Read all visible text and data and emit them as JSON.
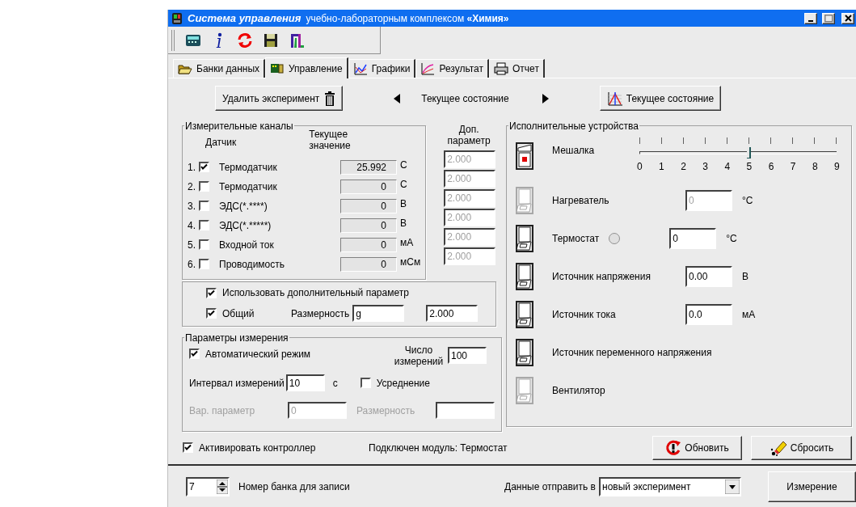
{
  "window": {
    "title_main": "Система управления",
    "title_rest": "учебно-лабораторным комплексом **«Химия»**"
  },
  "tabs": [
    {
      "label": "Банки данных",
      "selected": false
    },
    {
      "label": "Управление",
      "selected": true
    },
    {
      "label": "Графики",
      "selected": false
    },
    {
      "label": "Результат",
      "selected": false
    },
    {
      "label": "Отчет",
      "selected": false
    }
  ],
  "actions": {
    "delete_button": "Удалить эксперимент",
    "nav_label": "Текущее состояние",
    "state_button": "Текущее состояние"
  },
  "channels": {
    "title": "Измерительные каналы",
    "sensor_header": "Датчик",
    "value_header": "Текущее значение",
    "extra_header": "Доп. параметр",
    "rows": [
      {
        "number": "1.",
        "checked": true,
        "name": "Термодатчик",
        "value": "25.992",
        "unit": "C",
        "extra": "2.000",
        "extra_disabled": true
      },
      {
        "number": "2.",
        "checked": false,
        "name": "Термодатчик",
        "value": "0",
        "unit": "C",
        "extra": "2.000",
        "extra_disabled": true
      },
      {
        "number": "3.",
        "checked": false,
        "name": "ЭДС(*.****)",
        "value": "0",
        "unit": "B",
        "extra": "2.000",
        "extra_disabled": true
      },
      {
        "number": "4.",
        "checked": false,
        "name": "ЭДС(*.*****)",
        "value": "0",
        "unit": "B",
        "extra": "2.000",
        "extra_disabled": true
      },
      {
        "number": "5.",
        "checked": false,
        "name": "Входной ток",
        "value": "0",
        "unit": "мА",
        "extra": "2.000",
        "extra_disabled": true
      },
      {
        "number": "6.",
        "checked": false,
        "name": "Проводимость",
        "value": "0",
        "unit": "мСм",
        "extra": "2.000",
        "extra_disabled": true
      }
    ],
    "use_extra": {
      "label": "Использовать дополнительный параметр",
      "checked": true
    },
    "common": {
      "label": "Общий",
      "checked": true
    },
    "dimension_label": "Размерность",
    "dimension_value": "g",
    "common_value": "2.000"
  },
  "measure": {
    "title": "Параметры измерения",
    "auto": {
      "label": "Автоматический режим",
      "checked": true
    },
    "count_label": "Число измерений",
    "count_value": "100",
    "interval_label": "Интервал измерений",
    "interval_value": "10",
    "interval_unit": "с",
    "averaging": {
      "label": "Усреднение",
      "checked": false
    },
    "var_param": {
      "label": "Вар. параметр",
      "value": "0",
      "disabled": true
    },
    "var_dimension": {
      "label": "Размерность",
      "disabled": true
    }
  },
  "devices": {
    "title": "Исполнительные устройства",
    "items": [
      {
        "kind": "slider",
        "name": "Мешалка",
        "on": true,
        "disabled": false,
        "ticks": [
          "0",
          "1",
          "2",
          "3",
          "4",
          "5",
          "6",
          "7",
          "8",
          "9"
        ],
        "level": 0.556
      },
      {
        "kind": "field",
        "name": "Нагреватель",
        "on": false,
        "disabled": true,
        "value": "0",
        "unit": "°C"
      },
      {
        "kind": "field",
        "name": "Термостат",
        "on": false,
        "disabled": false,
        "lamp_on": false,
        "value": "0",
        "unit": "°C"
      },
      {
        "kind": "field",
        "name": "Источник напряжения",
        "on": false,
        "disabled": false,
        "value": "0.00",
        "unit": "B"
      },
      {
        "kind": "field",
        "name": "Источник тока",
        "on": false,
        "disabled": false,
        "value": "0.0",
        "unit": "мА"
      },
      {
        "kind": "plain",
        "name": "Источник переменного напряжения",
        "on": false,
        "disabled": false
      },
      {
        "kind": "plain",
        "name": "Вентилятор",
        "on": false,
        "disabled": true
      }
    ]
  },
  "footer": {
    "activate": {
      "label": "Активировать контроллер",
      "checked": true
    },
    "module_text": "Подключен модуль: Термостат",
    "refresh_button": "Обновить",
    "reset_button": "Сбросить"
  },
  "bottom_bar": {
    "bank_number": "7",
    "bank_label": "Номер банка для записи",
    "send_label": "Данные отправить в",
    "send_value": "новый эксперимент",
    "measure_button": "Измерение"
  }
}
